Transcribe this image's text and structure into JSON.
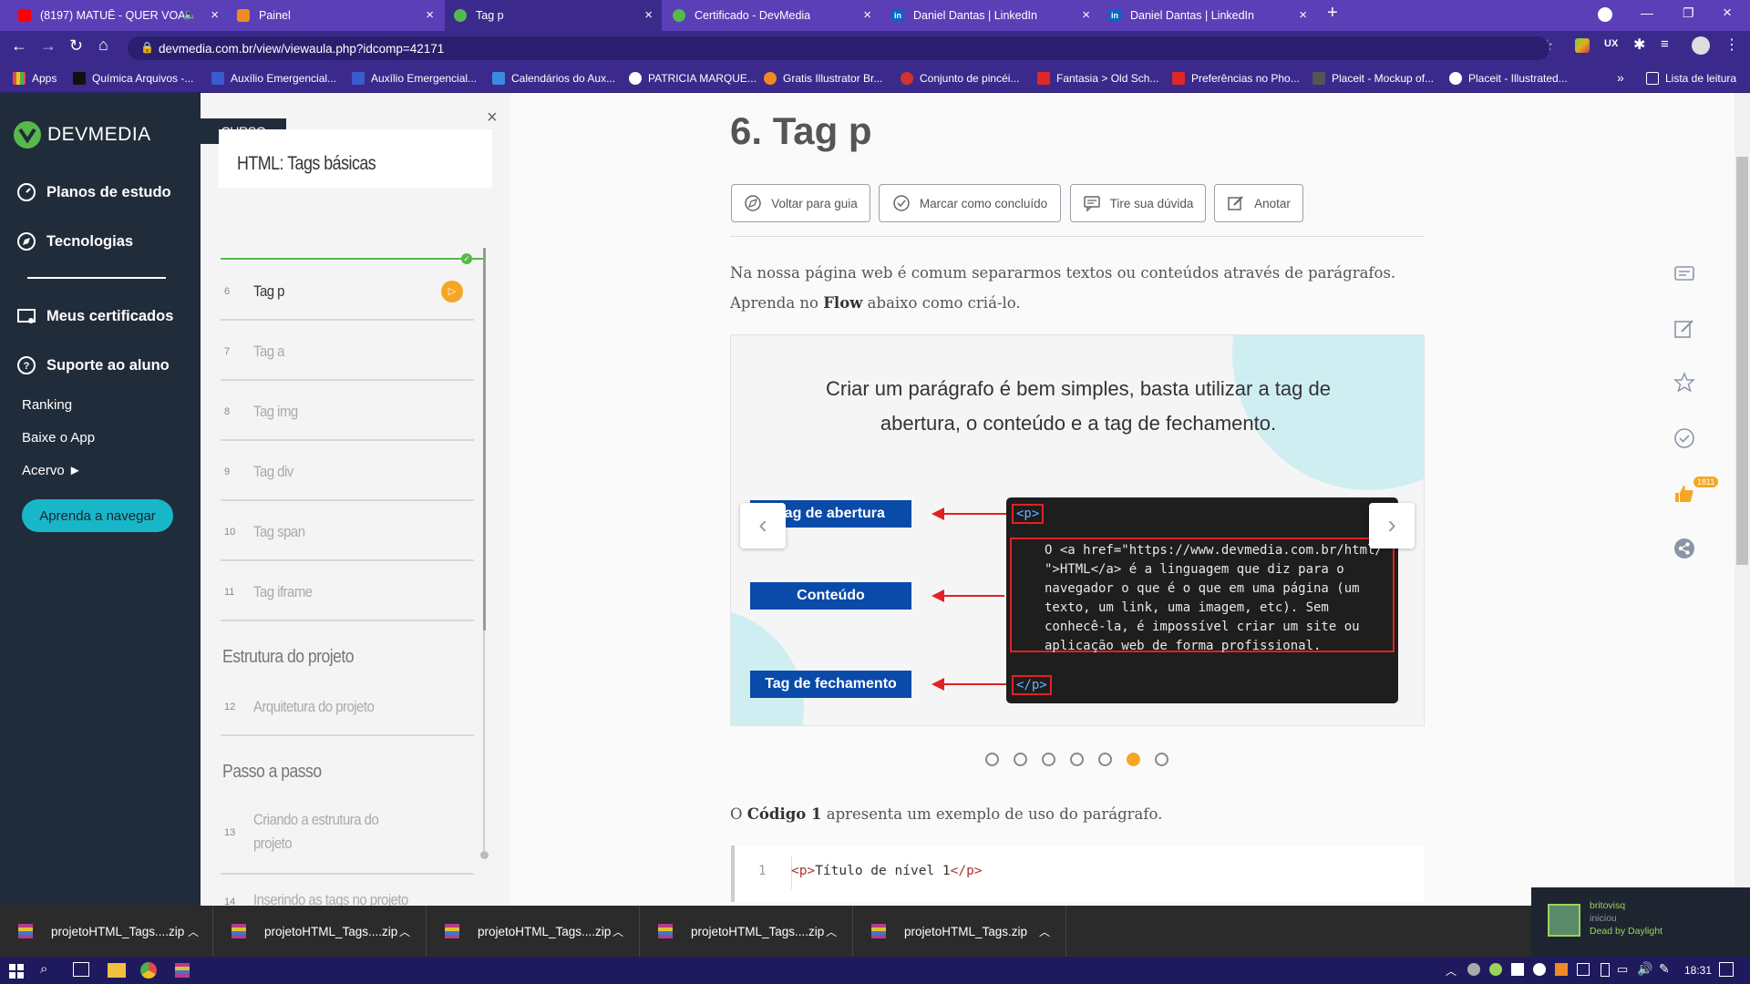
{
  "browser": {
    "tabs": [
      {
        "title": "(8197) MATUÊ - QUER VOAR",
        "icon": "youtube-icon",
        "color": "#ff0000"
      },
      {
        "title": "Painel",
        "icon": "panel-icon",
        "color": "#f08a24"
      },
      {
        "title": "Tag p",
        "icon": "devmedia-icon",
        "color": "#56b94b"
      },
      {
        "title": "Certificado - DevMedia",
        "icon": "devmedia-icon",
        "color": "#56b94b"
      },
      {
        "title": "Daniel Dantas | LinkedIn",
        "icon": "linkedin-icon",
        "color": "#0a66c2"
      },
      {
        "title": "Daniel Dantas | LinkedIn",
        "icon": "linkedin-icon",
        "color": "#0a66c2"
      }
    ],
    "url": "devmedia.com.br/view/viewaula.php?idcomp=42171",
    "bookmarks": [
      {
        "label": "Apps",
        "color": "#e34b4b"
      },
      {
        "label": "Química Arquivos -...",
        "color": "#222222"
      },
      {
        "label": "Auxílio Emergencial...",
        "color": "#3b5ccc"
      },
      {
        "label": "Auxílio Emergencial...",
        "color": "#3b5ccc"
      },
      {
        "label": "Calendários do Aux...",
        "color": "#3b8ce0"
      },
      {
        "label": "PATRICIA MARQUE...",
        "color": "#ffffff"
      },
      {
        "label": "Gratis Illustrator Br...",
        "color": "#f08a24"
      },
      {
        "label": "Conjunto de pincéi...",
        "color": "#d0342c"
      },
      {
        "label": "Fantasia > Old Sch...",
        "color": "#e02828"
      },
      {
        "label": "Preferências no Pho...",
        "color": "#e02828"
      },
      {
        "label": "Placeit - Mockup of...",
        "color": "#555555"
      },
      {
        "label": "Placeit - Illustrated...",
        "color": "#ffffff"
      }
    ],
    "bookmarks_more": "»",
    "reading_list": "Lista de leitura"
  },
  "nav": {
    "logo": "DEVMEDIA",
    "items": [
      {
        "label": "Planos de estudo",
        "icon": "dashboard-icon"
      },
      {
        "label": "Tecnologias",
        "icon": "compass-icon"
      },
      {
        "label": "Meus certificados",
        "icon": "certificate-icon"
      },
      {
        "label": "Suporte ao aluno",
        "icon": "help-icon"
      }
    ],
    "sub": [
      {
        "label": "Ranking"
      },
      {
        "label": "Baixe o App"
      },
      {
        "label": "Acervo ►"
      }
    ],
    "cta": "Aprenda a navegar"
  },
  "course": {
    "badge": "CURSO",
    "title": "HTML: Tags básicas",
    "lessons": [
      {
        "num": "6",
        "label": "Tag p"
      },
      {
        "num": "7",
        "label": "Tag a"
      },
      {
        "num": "8",
        "label": "Tag img"
      },
      {
        "num": "9",
        "label": "Tag div"
      },
      {
        "num": "10",
        "label": "Tag span"
      },
      {
        "num": "11",
        "label": "Tag iframe"
      }
    ],
    "section1": "Estrutura do projeto",
    "lesson12": {
      "num": "12",
      "label": "Arquitetura do projeto"
    },
    "section2": "Passo a passo",
    "lesson13": {
      "num": "13",
      "label_line1": "Criando a estrutura do",
      "label_line2": "projeto"
    },
    "lesson14": {
      "num": "14",
      "label": "Inserindo as tags no projeto"
    }
  },
  "content": {
    "heading": "6. Tag p",
    "buttons": [
      {
        "label": "Voltar para guia",
        "icon": "compass-icon"
      },
      {
        "label": "Marcar como concluído",
        "icon": "check-circle-icon"
      },
      {
        "label": "Tire sua dúvida",
        "icon": "chat-icon"
      },
      {
        "label": "Anotar",
        "icon": "edit-icon"
      }
    ],
    "intro_line1": "Na nossa página web é comum separarmos textos ou conteúdos através de parágrafos.",
    "intro_line2_pre": "Aprenda no ",
    "intro_line2_bold": "Flow",
    "intro_line2_post": " abaixo como criá-lo.",
    "slide": {
      "title_line1": "Criar um parágrafo é bem simples, basta utilizar a tag de",
      "title_line2": "abertura, o conteúdo e a tag de fechamento.",
      "labels": [
        "Tag de abertura",
        "Conteúdo",
        "Tag de fechamento"
      ],
      "open_tag": "<p>",
      "close_tag": "</p>",
      "code_lines": [
        "O <a href=\"https://www.devmedia.com.br/html/",
        "\">HTML</a> é a linguagem que diz para o",
        "navegador o que é o que em uma página (um",
        "texto, um link, uma imagem, etc). Sem",
        "conhecê-la, é impossível criar um site ou",
        "aplicação web de forma profissional."
      ]
    },
    "carousel_total": 7,
    "carousel_active": 6,
    "code_intro_pre": "O ",
    "code_intro_bold": "Código 1",
    "code_intro_post": " apresenta um exemplo de uso do parágrafo.",
    "code1": {
      "line_number": "1",
      "open": "<p>",
      "text": "Título de nível 1",
      "close": "</p>"
    }
  },
  "rail": {
    "like_count": "1811"
  },
  "downloads": [
    {
      "name": "projetoHTML_Tags....zip"
    },
    {
      "name": "projetoHTML_Tags....zip"
    },
    {
      "name": "projetoHTML_Tags....zip"
    },
    {
      "name": "projetoHTML_Tags....zip"
    },
    {
      "name": "projetoHTML_Tags.zip"
    }
  ],
  "notification": {
    "user": "britovisq",
    "action": "iniciou",
    "game": "Dead by Daylight"
  },
  "taskbar": {
    "time": "18:31"
  },
  "colors": {
    "accent_orange": "#f5a623",
    "green": "#56b94b",
    "teal": "#17b7c9",
    "brand_blue": "#0a4aa8",
    "arrow_red": "#e02222"
  }
}
